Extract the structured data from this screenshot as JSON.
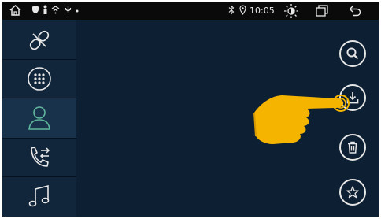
{
  "status_bar": {
    "time": "10:05",
    "icons": [
      "home-icon",
      "shield-icon",
      "person-icon",
      "signal-icon",
      "usb-icon",
      "dot-icon",
      "bluetooth-icon",
      "location-icon",
      "brightness-icon",
      "recent-apps-icon",
      "back-icon"
    ]
  },
  "sidebar": {
    "items": [
      {
        "icon": "link-icon",
        "active": false
      },
      {
        "icon": "dialpad-icon",
        "active": false
      },
      {
        "icon": "contacts-icon",
        "active": true
      },
      {
        "icon": "call-log-icon",
        "active": false
      },
      {
        "icon": "music-icon",
        "active": false
      }
    ]
  },
  "right_actions": [
    {
      "icon": "search-icon"
    },
    {
      "icon": "download-icon"
    },
    {
      "icon": "trash-icon"
    },
    {
      "icon": "star-icon"
    }
  ],
  "overlay": {
    "icon": "pointing-hand-icon"
  },
  "colors": {
    "background": "#0c1f33",
    "sidebar": "#12263b",
    "active_item": "#18324c",
    "accent": "#5fb69a",
    "statusbar": "#0a0a0a",
    "hand": "#f5b400"
  }
}
